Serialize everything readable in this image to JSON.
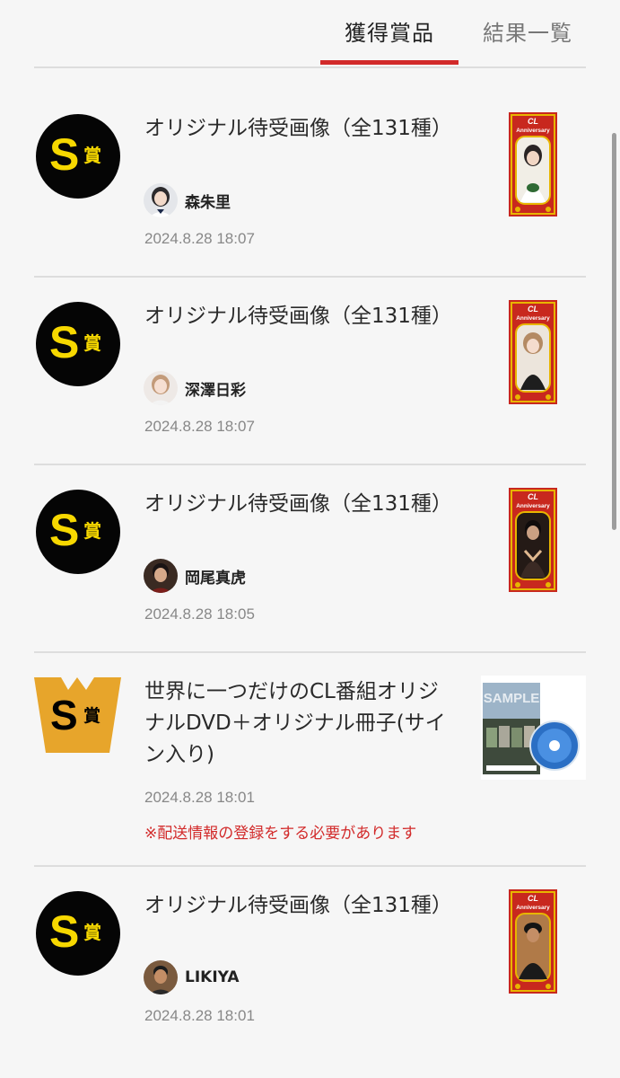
{
  "tabs": {
    "prizes_label": "獲得賞品",
    "results_label": "結果一覧"
  },
  "badges": {
    "s_letter": "S",
    "prize_kanji": "賞",
    "w_letter": "W"
  },
  "prizes": [
    {
      "badge": "S",
      "title": "オリジナル待受画像（全131種）",
      "member": "森朱里",
      "timestamp": "2024.8.28 18:07",
      "notice": ""
    },
    {
      "badge": "S",
      "title": "オリジナル待受画像（全131種）",
      "member": "深澤日彩",
      "timestamp": "2024.8.28 18:07",
      "notice": ""
    },
    {
      "badge": "S",
      "title": "オリジナル待受画像（全131種）",
      "member": "岡尾真虎",
      "timestamp": "2024.8.28 18:05",
      "notice": ""
    },
    {
      "badge": "WS",
      "title": "世界に一つだけのCL番組オリジナルDVD＋オリジナル冊子(サイン入り)",
      "member": "",
      "timestamp": "2024.8.28 18:01",
      "notice": "※配送情報の登録をする必要があります"
    },
    {
      "badge": "S",
      "title": "オリジナル待受画像（全131種）",
      "member": "LIKIYA",
      "timestamp": "2024.8.28 18:01",
      "notice": ""
    }
  ],
  "thumbnail_text": {
    "card_brand": "CL",
    "card_caption": "Anniversary",
    "dvd_watermark": "SAMPLE"
  },
  "colors": {
    "accent_red": "#d22a2a",
    "badge_black": "#050505",
    "badge_yellow": "#f7d800",
    "ws_badge_orange": "#e7a52b",
    "card_red": "#c8281e",
    "card_gold": "#e8b500"
  }
}
